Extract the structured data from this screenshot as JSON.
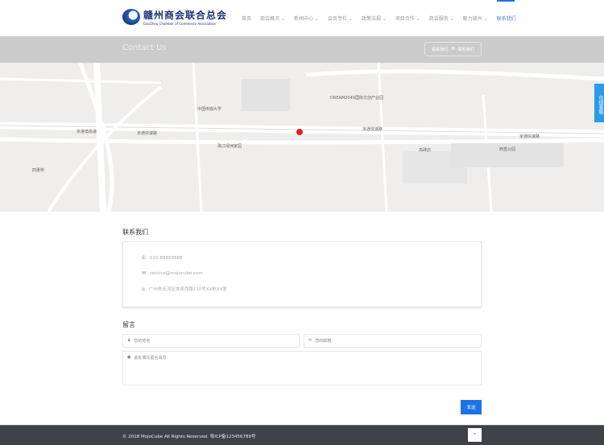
{
  "logo": {
    "cn": "赣州商会联合总会",
    "en": "GanZhou Chamber of Commerce Association"
  },
  "nav": [
    {
      "label": "首页"
    },
    {
      "label": "商会概况 ⌄"
    },
    {
      "label": "新闻中心 ⌄"
    },
    {
      "label": "会员专栏 ⌄"
    },
    {
      "label": "政策法规 ⌄"
    },
    {
      "label": "项目合作 ⌄"
    },
    {
      "label": "商会服务 ⌄"
    },
    {
      "label": "魅力赣州 ⌄"
    },
    {
      "label": "联系我们"
    }
  ],
  "banner": {
    "title": "Contact Us",
    "crumb1": "联系我们",
    "crumb2": "联系我们"
  },
  "map": {
    "labels": [
      "京港澳高速",
      "京通快速路",
      "京通快速路",
      "京通快速路",
      "中国传媒大学",
      "珠江绿洲家园",
      "DREAM2049国际文创产业园",
      "四惠桥",
      "西直公园",
      "高碑店"
    ]
  },
  "side_widget": "在线客服",
  "contact": {
    "title": "联系我们",
    "phone": "020-88888888",
    "email": "service@mojocube.com",
    "address": "广州市天河区体育西路110号XX栋XX室"
  },
  "message": {
    "title": "留言",
    "name_placeholder": "您的姓名",
    "email_placeholder": "您的邮箱",
    "msg_placeholder": "此处填写留言消息",
    "send": "发送"
  },
  "footer": {
    "copyright": "© 2018 MojoCube All Rights Reserved. 粤ICP备123456789号",
    "top": "⌃"
  }
}
